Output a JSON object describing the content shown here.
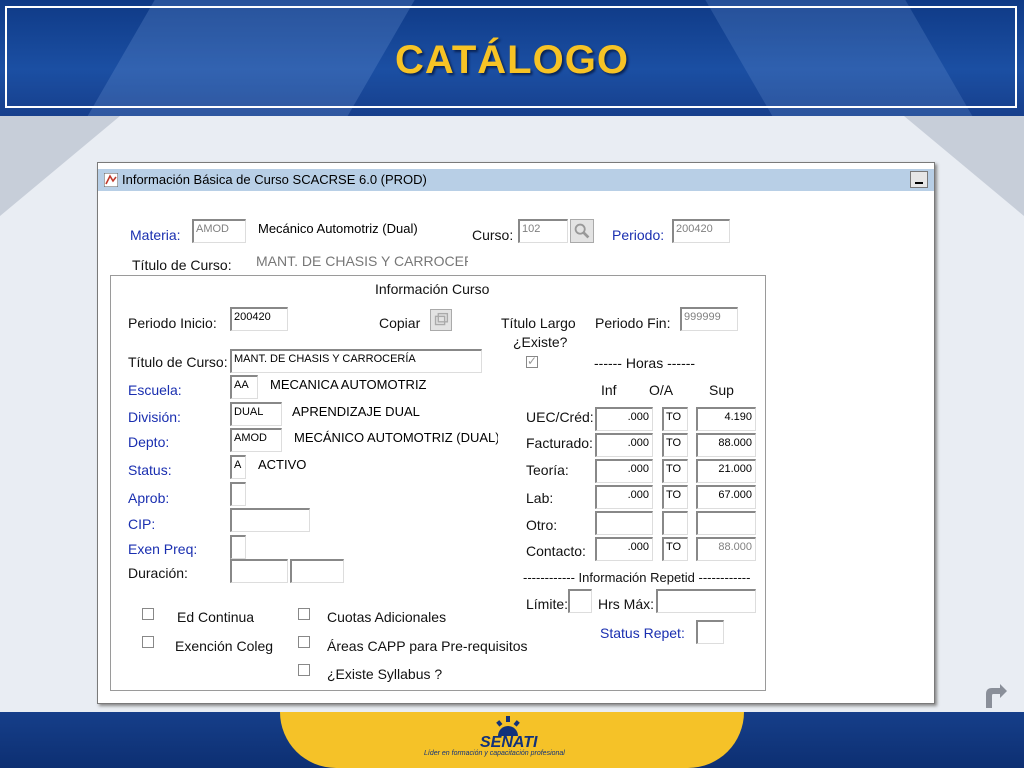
{
  "slide": {
    "title": "CATÁLOGO",
    "logo_name": "SENATI",
    "logo_tagline": "Líder en formación y capacitación profesional"
  },
  "window": {
    "title": "Información Básica de Curso  SCACRSE  6.0  (PROD)"
  },
  "top": {
    "materia_label": "Materia:",
    "materia_code": "AMOD",
    "materia_desc": "Mecánico Automotriz (Dual)",
    "curso_label": "Curso:",
    "curso_value": "102",
    "periodo_label": "Periodo:",
    "periodo_value": "200420",
    "titulo_label": "Título de Curso:",
    "titulo_value": "MANT. DE CHASIS Y CARROCER"
  },
  "info": {
    "section_title": "Información Curso",
    "periodo_inicio_label": "Periodo Inicio:",
    "periodo_inicio_value": "200420",
    "copiar_label": "Copiar",
    "titulo_largo_label": "Título Largo",
    "existe_label": "¿Existe?",
    "periodo_fin_label": "Periodo Fin:",
    "periodo_fin_value": "999999",
    "titulo_curso_label": "Título de Curso:",
    "titulo_curso_value": "MANT. DE CHASIS Y CARROCERÍA",
    "horas_label": "------      Horas    ------",
    "escuela_label": "Escuela:",
    "escuela_code": "AA",
    "escuela_desc": "MECANICA AUTOMOTRIZ",
    "division_label": "División:",
    "division_code": "DUAL",
    "division_desc": "APRENDIZAJE DUAL",
    "depto_label": "Depto:",
    "depto_code": "AMOD",
    "depto_desc": "MECÁNICO AUTOMOTRIZ (DUAL)",
    "status_label": "Status:",
    "status_code": "A",
    "status_desc": "ACTIVO",
    "aprob_label": "Aprob:",
    "cip_label": "CIP:",
    "exen_label": "Exen Preq:",
    "duracion_label": "Duración:"
  },
  "hours": {
    "col_inf": "Inf",
    "col_oa": "O/A",
    "col_sup": "Sup",
    "rows": [
      {
        "label": "UEC/Créd:",
        "inf": ".000",
        "oa": "TO",
        "sup": "4.190"
      },
      {
        "label": "Facturado:",
        "inf": ".000",
        "oa": "TO",
        "sup": "88.000"
      },
      {
        "label": "Teoría:",
        "inf": ".000",
        "oa": "TO",
        "sup": "21.000"
      },
      {
        "label": "Lab:",
        "inf": ".000",
        "oa": "TO",
        "sup": "67.000"
      },
      {
        "label": "Otro:",
        "inf": "",
        "oa": "",
        "sup": ""
      },
      {
        "label": "Contacto:",
        "inf": ".000",
        "oa": "TO",
        "sup": "88.000"
      }
    ]
  },
  "repetid": {
    "header": "------------ Información Repetid ------------",
    "limite_label": "Límite:",
    "hrs_max_label": "Hrs Máx:",
    "status_repet_label": "Status Repet:"
  },
  "checks": {
    "ed_continua": "Ed Continua",
    "exencion_coleg": "Exención Coleg",
    "cuotas_adicionales": "Cuotas Adicionales",
    "areas_capp": "Áreas CAPP para Pre-requisitos",
    "existe_syllabus": "¿Existe Syllabus ?"
  }
}
